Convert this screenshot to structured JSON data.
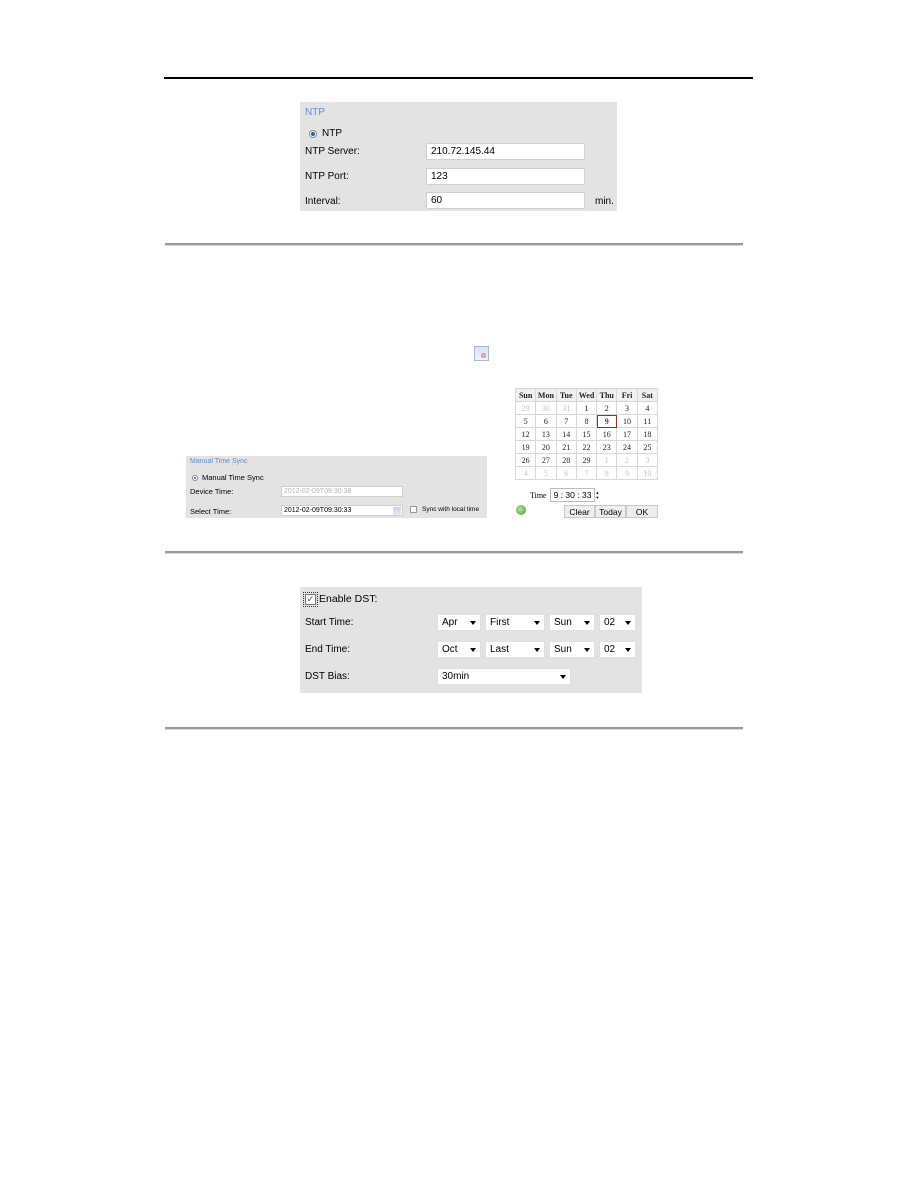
{
  "ntp": {
    "title": "NTP",
    "radio_label": "NTP",
    "server_label": "NTP Server:",
    "server_value": "210.72.145.44",
    "port_label": "NTP Port:",
    "port_value": "123",
    "interval_label": "Interval:",
    "interval_value": "60",
    "interval_unit": "min."
  },
  "calendar_icon": "calendar-icon",
  "manual_time_sync": {
    "title": "Manual Time Sync",
    "radio_label": "Manual Time Sync",
    "device_time_label": "Device Time:",
    "device_time_value": "2012-02-09T09:30:38",
    "select_time_label": "Select Time:",
    "select_time_value": "2012-02-09T09:30:33",
    "sync_local_label": "Sync with local time",
    "sync_local_checked": false
  },
  "calendar": {
    "weekdays": [
      "Sun",
      "Mon",
      "Tue",
      "Wed",
      "Thu",
      "Fri",
      "Sat"
    ],
    "weeks": [
      [
        {
          "d": "29",
          "other": true
        },
        {
          "d": "30",
          "other": true
        },
        {
          "d": "31",
          "other": true
        },
        {
          "d": "1"
        },
        {
          "d": "2"
        },
        {
          "d": "3"
        },
        {
          "d": "4"
        }
      ],
      [
        {
          "d": "5"
        },
        {
          "d": "6"
        },
        {
          "d": "7"
        },
        {
          "d": "8"
        },
        {
          "d": "9",
          "selected": true
        },
        {
          "d": "10"
        },
        {
          "d": "11"
        }
      ],
      [
        {
          "d": "12"
        },
        {
          "d": "13"
        },
        {
          "d": "14"
        },
        {
          "d": "15"
        },
        {
          "d": "16"
        },
        {
          "d": "17"
        },
        {
          "d": "18"
        }
      ],
      [
        {
          "d": "19"
        },
        {
          "d": "20"
        },
        {
          "d": "21"
        },
        {
          "d": "22"
        },
        {
          "d": "23"
        },
        {
          "d": "24"
        },
        {
          "d": "25"
        }
      ],
      [
        {
          "d": "26"
        },
        {
          "d": "27"
        },
        {
          "d": "28"
        },
        {
          "d": "29"
        },
        {
          "d": "1",
          "other": true
        },
        {
          "d": "2",
          "other": true
        },
        {
          "d": "3",
          "other": true
        }
      ],
      [
        {
          "d": "4",
          "other": true
        },
        {
          "d": "5",
          "other": true
        },
        {
          "d": "6",
          "other": true
        },
        {
          "d": "7",
          "other": true
        },
        {
          "d": "8",
          "other": true
        },
        {
          "d": "9",
          "other": true
        },
        {
          "d": "10",
          "other": true
        }
      ]
    ],
    "time_label": "Time",
    "time_value": "9 : 30 : 33",
    "clear_label": "Clear",
    "today_label": "Today",
    "ok_label": "OK"
  },
  "dst": {
    "enable_label": "Enable DST:",
    "enable_checked": true,
    "start_label": "Start Time:",
    "start": {
      "month": "Apr",
      "week": "First",
      "day": "Sun",
      "hour": "02"
    },
    "end_label": "End Time:",
    "end": {
      "month": "Oct",
      "week": "Last",
      "day": "Sun",
      "hour": "02"
    },
    "bias_label": "DST Bias:",
    "bias_value": "30min"
  }
}
